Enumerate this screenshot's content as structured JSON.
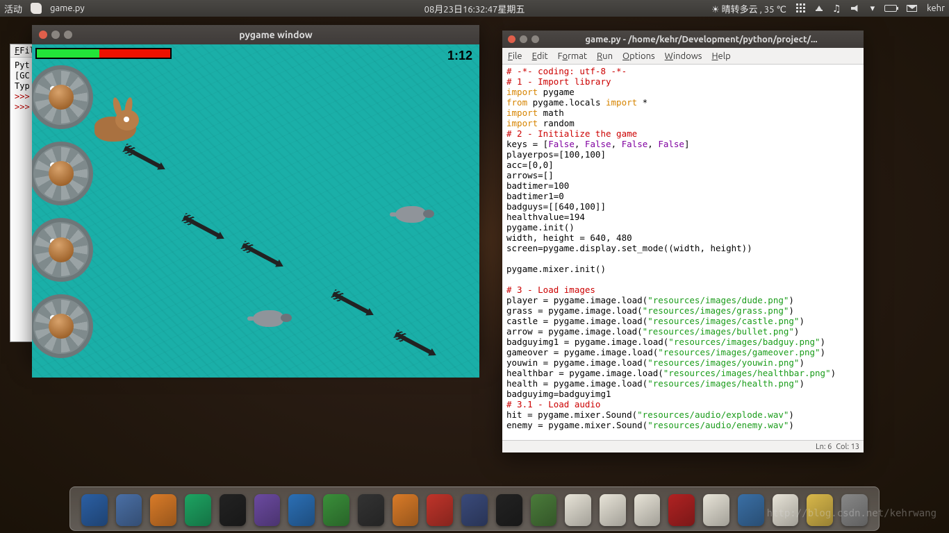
{
  "topbar": {
    "activities": "活动",
    "current_app": "game.py",
    "datetime": "08月23日16:32:47星期五",
    "weather": "晴转多云 , 35 ℃",
    "user": "kehr"
  },
  "terminal": {
    "menu_file": "File",
    "lines": [
      "Pyt",
      "[GC",
      "Typ",
      ">>>",
      ">>>"
    ]
  },
  "gamewin": {
    "title": "pygame window",
    "timer": "1:12",
    "health_pct": 47
  },
  "editor": {
    "title": "game.py - /home/kehr/Development/python/project/...",
    "menu": [
      "File",
      "Edit",
      "Format",
      "Run",
      "Options",
      "Windows",
      "Help"
    ],
    "status_ln": "Ln: 6",
    "status_col": "Col: 13",
    "code": [
      {
        "cls": "cm",
        "t": "# -*- coding: utf-8 -*-"
      },
      {
        "cls": "cm",
        "t": "# 1 - Import library"
      },
      {
        "seg": [
          {
            "cls": "kw",
            "t": "import"
          },
          {
            "t": " pygame"
          }
        ]
      },
      {
        "seg": [
          {
            "cls": "kw",
            "t": "from"
          },
          {
            "t": " pygame.locals "
          },
          {
            "cls": "kw",
            "t": "import"
          },
          {
            "t": " *"
          }
        ]
      },
      {
        "seg": [
          {
            "cls": "kw",
            "t": "import"
          },
          {
            "t": " math"
          }
        ]
      },
      {
        "seg": [
          {
            "cls": "kw",
            "t": "import"
          },
          {
            "t": " random"
          }
        ]
      },
      {
        "cls": "cm",
        "t": "# 2 - Initialize the game"
      },
      {
        "seg": [
          {
            "t": "keys = ["
          },
          {
            "cls": "fn",
            "t": "False"
          },
          {
            "t": ", "
          },
          {
            "cls": "fn",
            "t": "False"
          },
          {
            "t": ", "
          },
          {
            "cls": "fn",
            "t": "False"
          },
          {
            "t": ", "
          },
          {
            "cls": "fn",
            "t": "False"
          },
          {
            "t": "]"
          }
        ]
      },
      {
        "t": "playerpos=[100,100]"
      },
      {
        "t": "acc=[0,0]"
      },
      {
        "t": "arrows=[]"
      },
      {
        "t": "badtimer=100"
      },
      {
        "t": "badtimer1=0"
      },
      {
        "t": "badguys=[[640,100]]"
      },
      {
        "t": "healthvalue=194"
      },
      {
        "t": "pygame.init()"
      },
      {
        "t": "width, height = 640, 480"
      },
      {
        "t": "screen=pygame.display.set_mode((width, height))"
      },
      {
        "t": ""
      },
      {
        "t": "pygame.mixer.init()"
      },
      {
        "t": ""
      },
      {
        "cls": "cm",
        "t": "# 3 - Load images"
      },
      {
        "seg": [
          {
            "t": "player = pygame.image.load("
          },
          {
            "cls": "st",
            "t": "\"resources/images/dude.png\""
          },
          {
            "t": ")"
          }
        ]
      },
      {
        "seg": [
          {
            "t": "grass = pygame.image.load("
          },
          {
            "cls": "st",
            "t": "\"resources/images/grass.png\""
          },
          {
            "t": ")"
          }
        ]
      },
      {
        "seg": [
          {
            "t": "castle = pygame.image.load("
          },
          {
            "cls": "st",
            "t": "\"resources/images/castle.png\""
          },
          {
            "t": ")"
          }
        ]
      },
      {
        "seg": [
          {
            "t": "arrow = pygame.image.load("
          },
          {
            "cls": "st",
            "t": "\"resources/images/bullet.png\""
          },
          {
            "t": ")"
          }
        ]
      },
      {
        "seg": [
          {
            "t": "badguyimg1 = pygame.image.load("
          },
          {
            "cls": "st",
            "t": "\"resources/images/badguy.png\""
          },
          {
            "t": ")"
          }
        ]
      },
      {
        "seg": [
          {
            "t": "gameover = pygame.image.load("
          },
          {
            "cls": "st",
            "t": "\"resources/images/gameover.png\""
          },
          {
            "t": ")"
          }
        ]
      },
      {
        "seg": [
          {
            "t": "youwin = pygame.image.load("
          },
          {
            "cls": "st",
            "t": "\"resources/images/youwin.png\""
          },
          {
            "t": ")"
          }
        ]
      },
      {
        "seg": [
          {
            "t": "healthbar = pygame.image.load("
          },
          {
            "cls": "st",
            "t": "\"resources/images/healthbar.png\""
          },
          {
            "t": ")"
          }
        ]
      },
      {
        "seg": [
          {
            "t": "health = pygame.image.load("
          },
          {
            "cls": "st",
            "t": "\"resources/images/health.png\""
          },
          {
            "t": ")"
          }
        ]
      },
      {
        "t": "badguyimg=badguyimg1"
      },
      {
        "cls": "cm",
        "t": "# 3.1 - Load audio"
      },
      {
        "seg": [
          {
            "t": "hit = pygame.mixer.Sound("
          },
          {
            "cls": "st",
            "t": "\"resources/audio/explode.wav\""
          },
          {
            "t": ")"
          }
        ]
      },
      {
        "seg": [
          {
            "t": "enemy = pygame.mixer.Sound("
          },
          {
            "cls": "st",
            "t": "\"resources/audio/enemy.wav\""
          },
          {
            "t": ")"
          }
        ]
      }
    ]
  },
  "dock": {
    "colors": [
      "#2b5fa3",
      "#4a6fa5",
      "#d97b28",
      "#1da462",
      "#222",
      "#6b4aa0",
      "#2b6fb5",
      "#3a8f3a",
      "#333",
      "#d97b28",
      "#c0342a",
      "#3a4a7a",
      "#222",
      "#4a7b3a",
      "#e8e4d8",
      "#e8e4d8",
      "#e8e4d8",
      "#b02222",
      "#e8e4d8",
      "#3a6fa5",
      "#e8e4d8",
      "#d9b84a",
      "#888"
    ]
  },
  "watermark": "http://blog.csdn.net/kehrwang"
}
